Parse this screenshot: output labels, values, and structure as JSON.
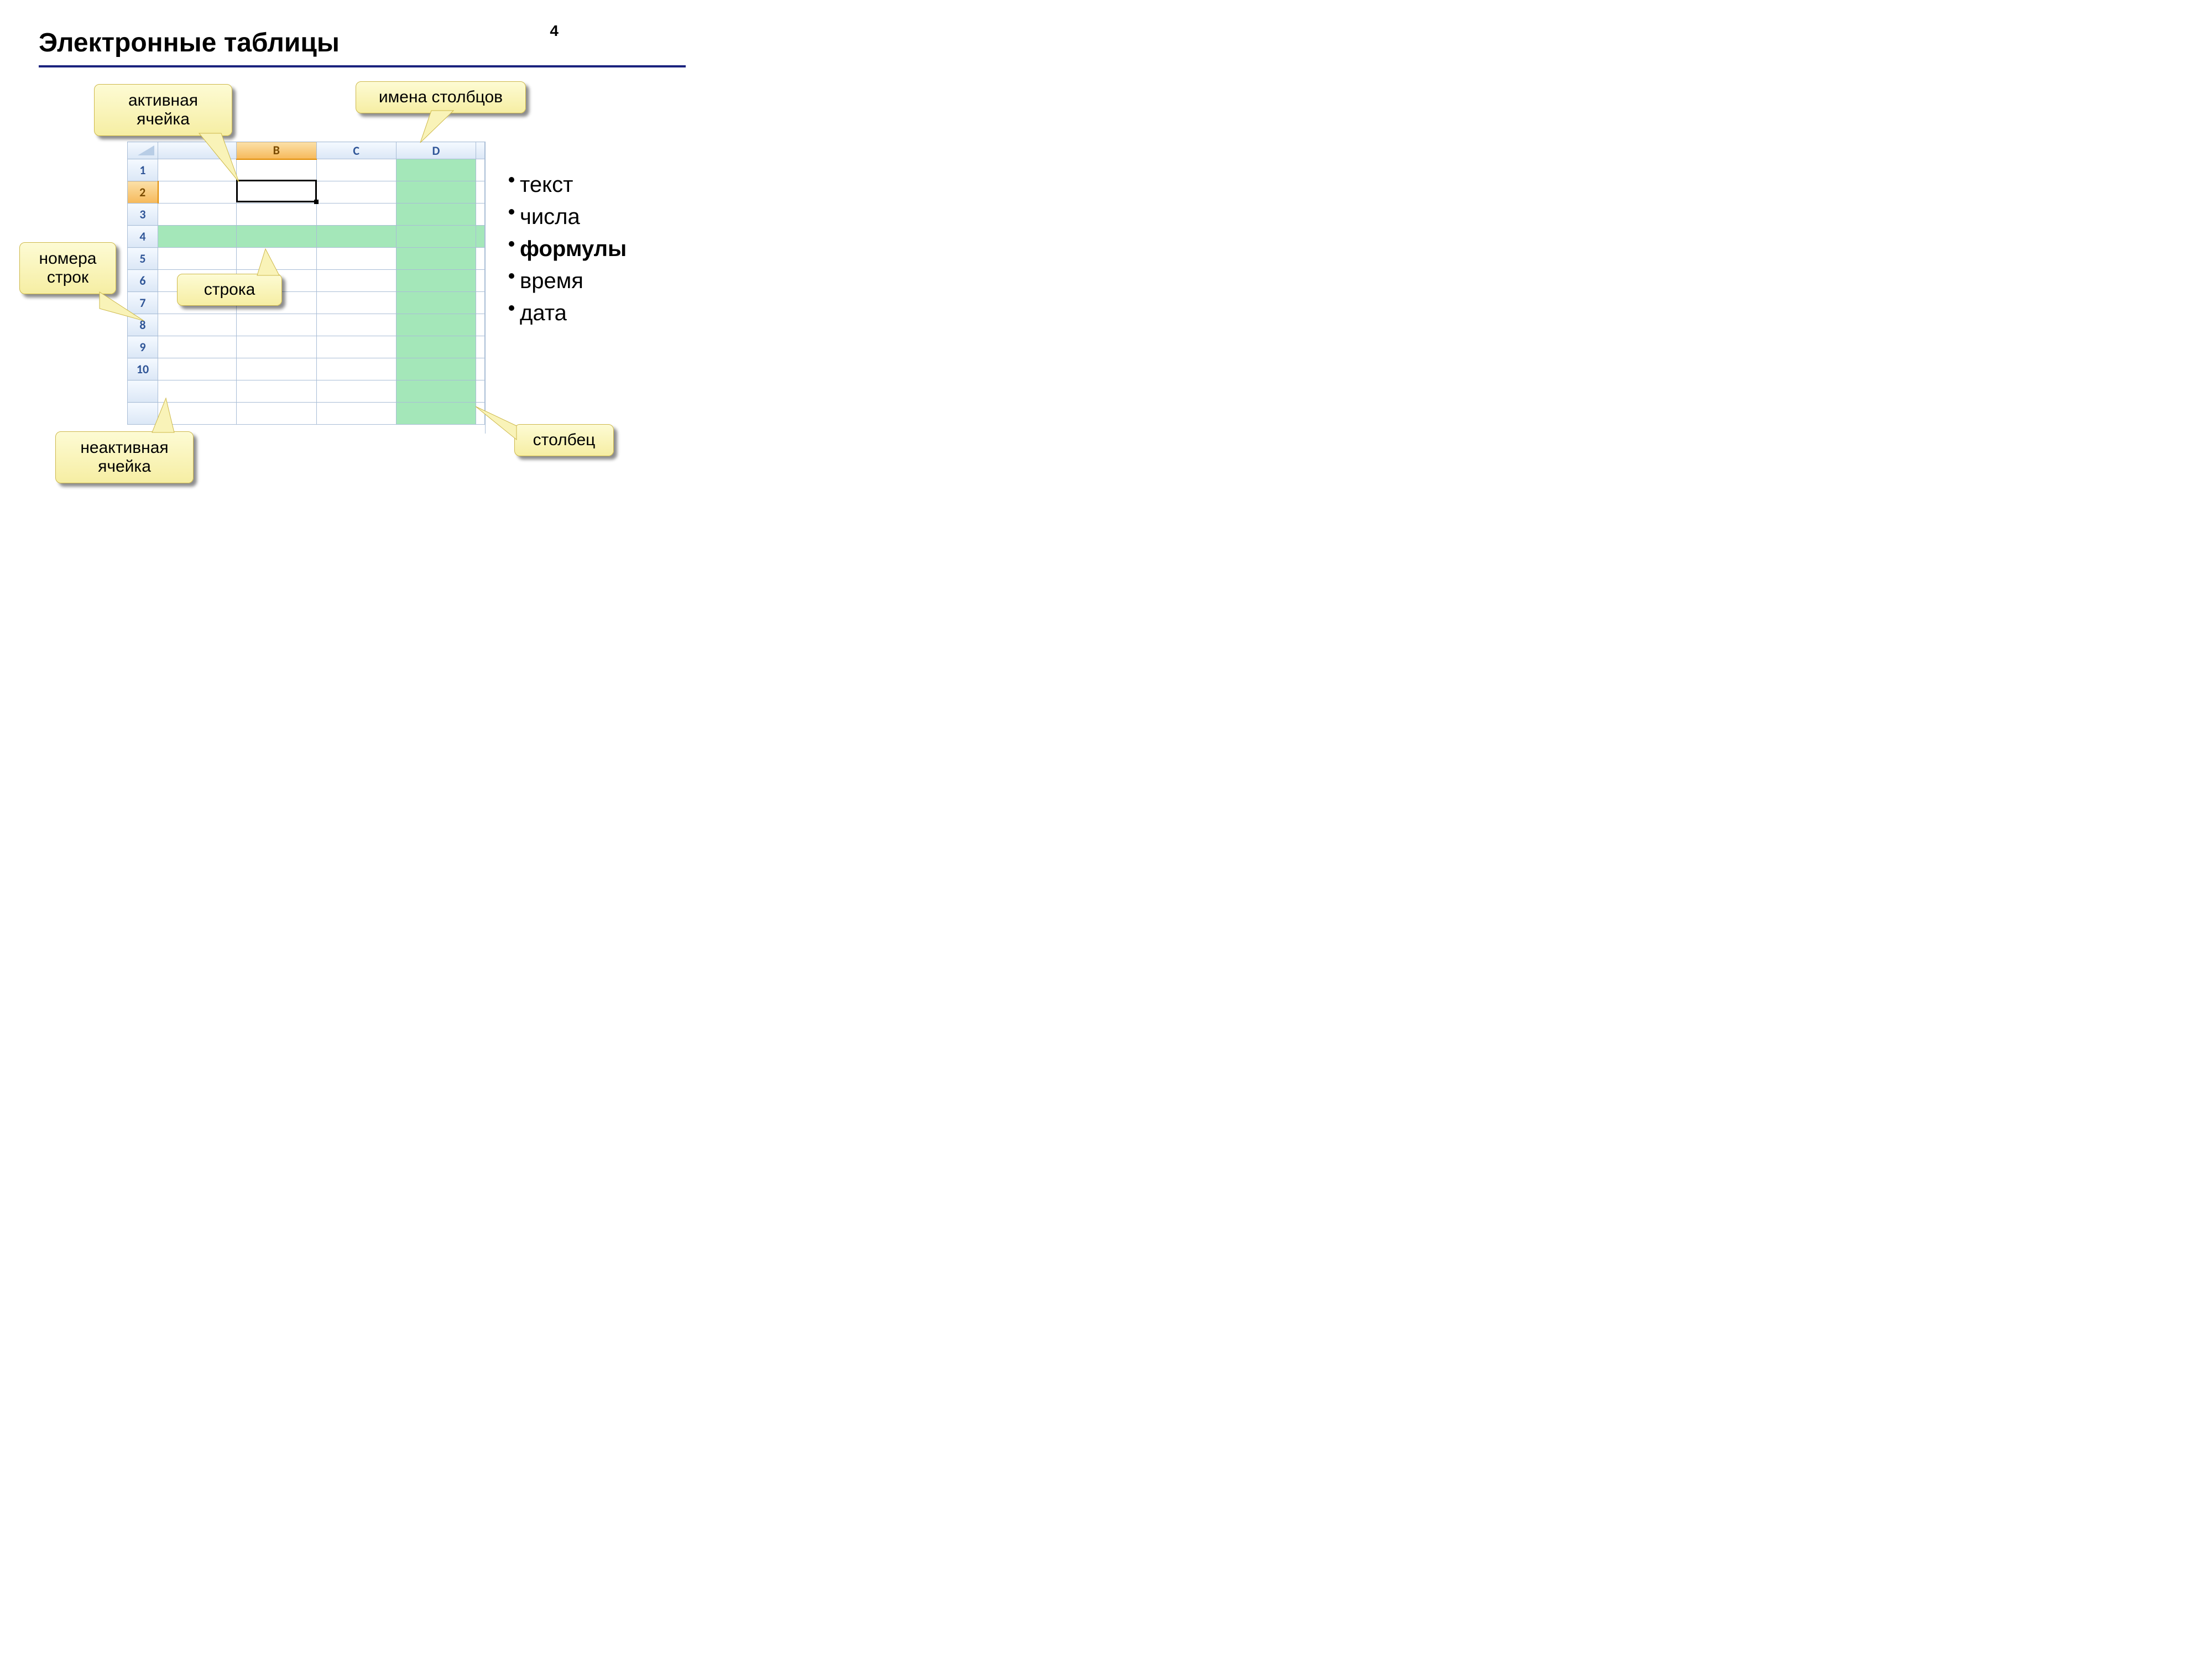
{
  "page_number": "4",
  "title": "Электронные таблицы",
  "columns": [
    "",
    "B",
    "C",
    "D"
  ],
  "rows": [
    "1",
    "2",
    "3",
    "4",
    "5",
    "6",
    "7",
    "8",
    "9",
    "10"
  ],
  "active_row": 2,
  "active_col": "B",
  "highlighted_row": 4,
  "highlighted_col": "D",
  "callouts": {
    "active_cell": "активная\nячейка",
    "col_names": "имена столбцов",
    "row_nums": "номера строк",
    "row_label": "строка",
    "inactive_cell": "неактивная\nячейка",
    "column_label": "столбец"
  },
  "data_types": [
    {
      "text": "текст",
      "bold": false
    },
    {
      "text": "числа",
      "bold": false
    },
    {
      "text": "формулы",
      "bold": true
    },
    {
      "text": "время",
      "bold": false
    },
    {
      "text": "дата",
      "bold": false
    }
  ]
}
